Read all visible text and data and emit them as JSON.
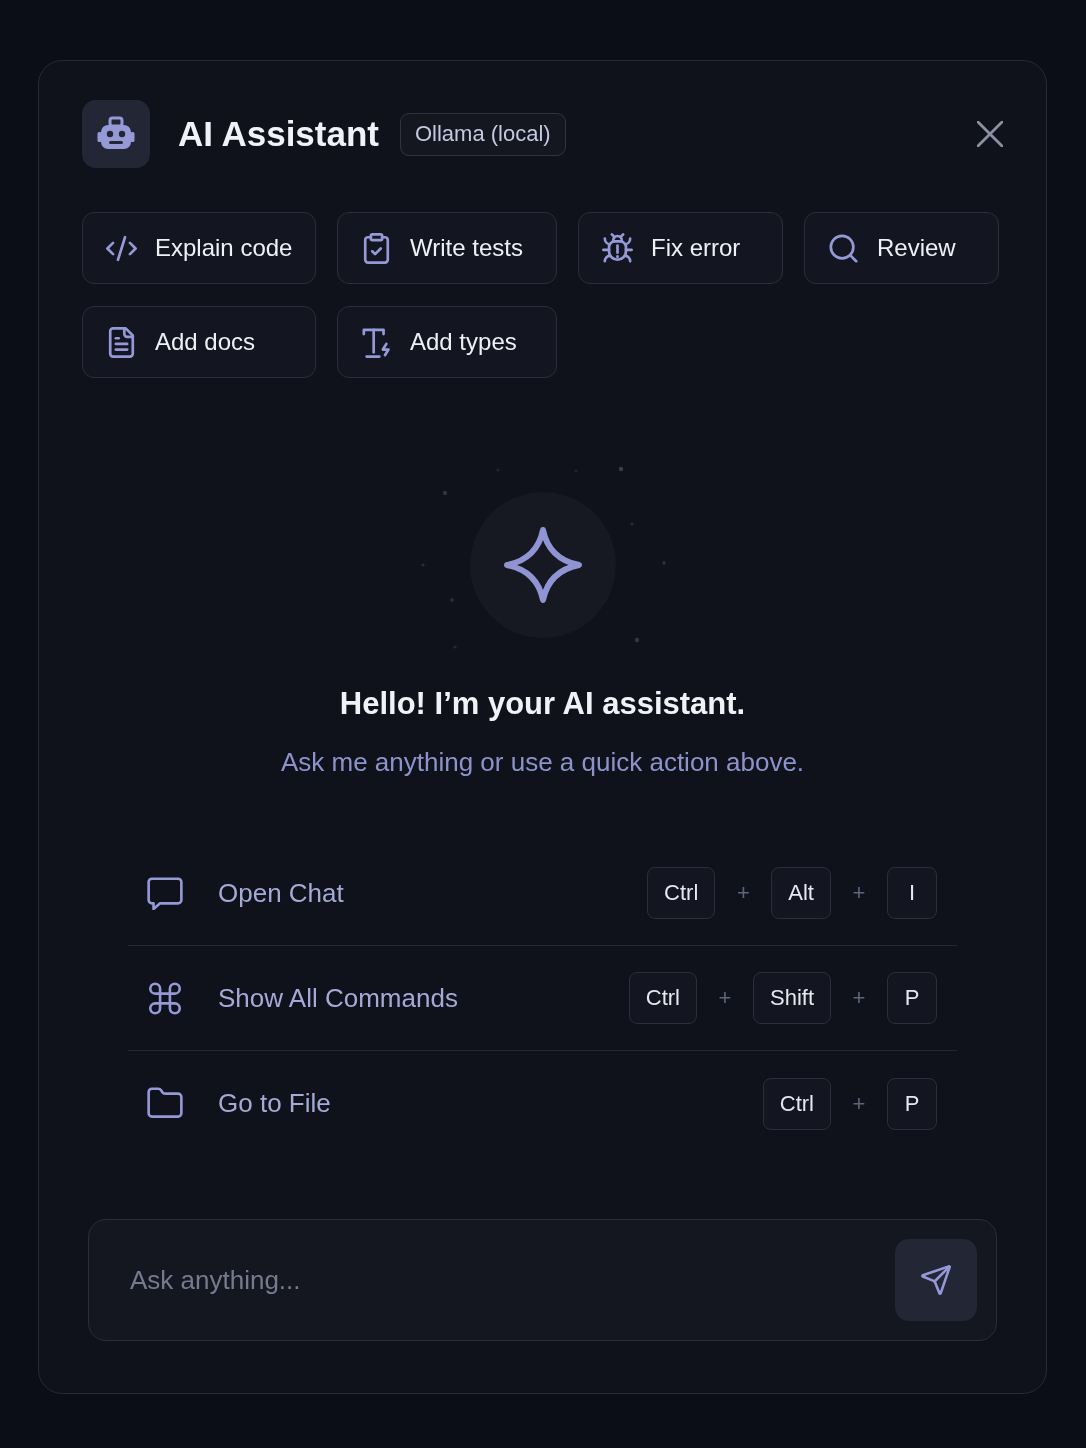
{
  "header": {
    "title": "AI Assistant",
    "badge": "Ollama (local)"
  },
  "quick_actions": [
    {
      "label": "Explain code"
    },
    {
      "label": "Write tests"
    },
    {
      "label": "Fix error"
    },
    {
      "label": "Review"
    },
    {
      "label": "Add docs"
    },
    {
      "label": "Add types"
    }
  ],
  "welcome": {
    "title": "Hello! I’m your AI assistant.",
    "subtitle": "Ask me anything or use a quick action above."
  },
  "shortcuts": [
    {
      "label": "Open Chat",
      "keys": [
        {
          "kind": "key",
          "text": "Ctrl"
        },
        {
          "kind": "plus",
          "text": "+"
        },
        {
          "kind": "key",
          "text": "Alt"
        },
        {
          "kind": "plus",
          "text": "+"
        },
        {
          "kind": "key",
          "text": "I"
        }
      ]
    },
    {
      "label": "Show All Commands",
      "keys": [
        {
          "kind": "key",
          "text": "Ctrl"
        },
        {
          "kind": "plus",
          "text": "+"
        },
        {
          "kind": "key",
          "text": "Shift"
        },
        {
          "kind": "plus",
          "text": "+"
        },
        {
          "kind": "key",
          "text": "P"
        }
      ]
    },
    {
      "label": "Go to File",
      "keys": [
        {
          "kind": "key",
          "text": "Ctrl"
        },
        {
          "kind": "plus",
          "text": "+"
        },
        {
          "kind": "key",
          "text": "P"
        }
      ]
    }
  ],
  "composer": {
    "placeholder": "Ask anything..."
  }
}
